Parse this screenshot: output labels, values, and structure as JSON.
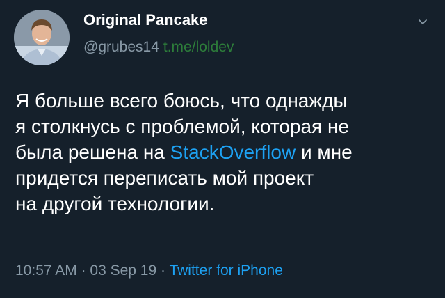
{
  "user": {
    "display_name": "Original Pancake",
    "handle": "@grubes14",
    "watermark": "t.me/loldev"
  },
  "tweet": {
    "line1": "Я больше всего боюсь, что однажды",
    "line2": "я столкнусь с проблемой, которая не",
    "line3_before": "была решена на ",
    "line3_link": "StackOverflow",
    "line3_after": " и мне",
    "line4": "придется переписать мой проект",
    "line5": "на другой технологии."
  },
  "meta": {
    "time": "10:57 AM",
    "sep1": " · ",
    "date": "03 Sep 19",
    "sep2": " · ",
    "source": "Twitter for iPhone"
  },
  "icons": {
    "caret": "chevron-down-icon",
    "avatar": "avatar"
  },
  "colors": {
    "background": "#15202b",
    "link": "#1da1f2",
    "secondary_text": "#8899a6",
    "watermark": "#2d7d3a"
  }
}
